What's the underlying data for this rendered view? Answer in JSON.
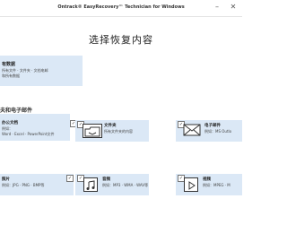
{
  "window": {
    "title": "Ontrack® EasyRecovery™ Technician for Windows",
    "minimize": "–",
    "close": "✕"
  },
  "heading": "选择恢复内容",
  "all_data": {
    "title": "有数据",
    "line1": "所有文件 · 文件夹 · 文档电邮",
    "line2": "和所有数据"
  },
  "section": "夫和电子邮件",
  "cards": [
    {
      "id": "office",
      "checked": "✓",
      "title": "办公文档",
      "desc1": "例如：",
      "desc2": "Word · Excel · PowerPoint文件"
    },
    {
      "id": "folder",
      "checked": "✓",
      "title": "文件夹",
      "desc1": "所有文件夹的内容"
    },
    {
      "id": "email",
      "checked": "✓",
      "title": "电子邮件",
      "desc1": "例如：MS Outlo"
    },
    {
      "id": "photo",
      "checked": "✓",
      "title": "照片",
      "desc1": "例如：JPG · PNG · BMP等"
    },
    {
      "id": "audio",
      "checked": "✓",
      "title": "音频",
      "desc1": "例如：MP3 · WMA · WAV等"
    },
    {
      "id": "video",
      "checked": "✓",
      "title": "视频",
      "desc1": "例如：MPEG · M"
    }
  ],
  "icons": {
    "folder": "folder-icon",
    "email": "envelope-icon",
    "audio": "music-note-icon",
    "video": "play-icon"
  }
}
